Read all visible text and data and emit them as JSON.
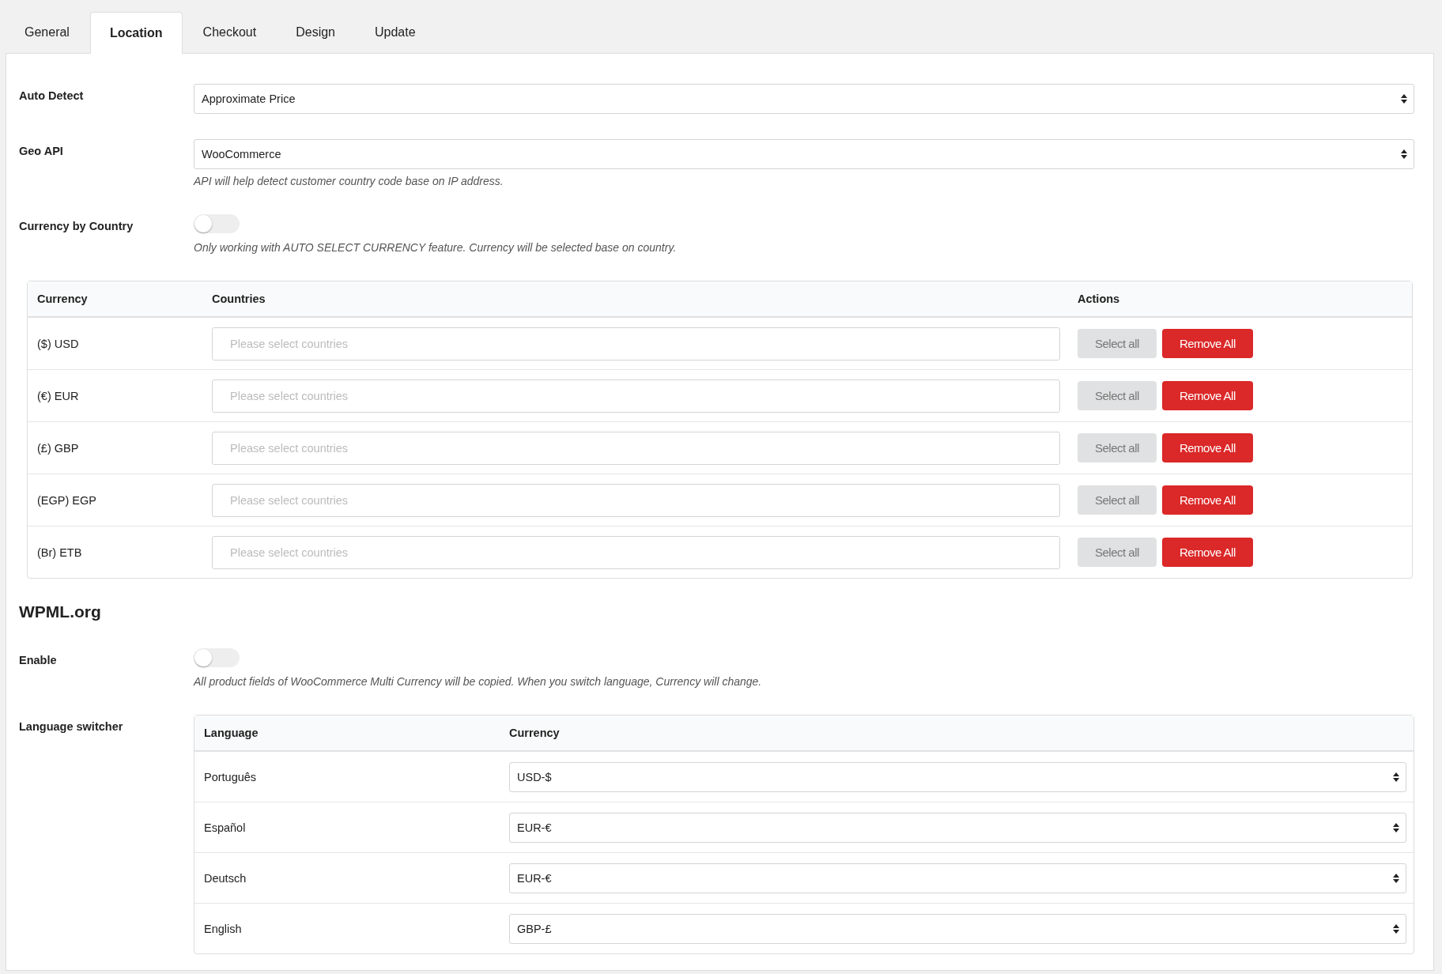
{
  "tabs": [
    {
      "label": "General",
      "selected": false
    },
    {
      "label": "Location",
      "selected": true
    },
    {
      "label": "Checkout",
      "selected": false
    },
    {
      "label": "Design",
      "selected": false
    },
    {
      "label": "Update",
      "selected": false
    }
  ],
  "settings": [
    {
      "label": "Auto Detect",
      "kind": "select",
      "value": "Approximate Price"
    },
    {
      "label": "Geo API",
      "kind": "select",
      "value": "WooCommerce",
      "hint": "API will help detect customer country code base on IP address."
    },
    {
      "label": "Currency by Country",
      "kind": "toggle",
      "on": false,
      "hint": "Only working with AUTO SELECT CURRENCY feature. Currency will be selected base on country."
    }
  ],
  "currency_table": {
    "columns": [
      "Currency",
      "Countries",
      "Actions"
    ],
    "rows": [
      {
        "currency": "($) USD",
        "placeholder": "Please select countries",
        "select_all": "Select all",
        "remove_all": "Remove All"
      },
      {
        "currency": "(€) EUR",
        "placeholder": "Please select countries",
        "select_all": "Select all",
        "remove_all": "Remove All"
      },
      {
        "currency": "(£) GBP",
        "placeholder": "Please select countries",
        "select_all": "Select all",
        "remove_all": "Remove All"
      },
      {
        "currency": "(EGP) EGP",
        "placeholder": "Please select countries",
        "select_all": "Select all",
        "remove_all": "Remove All"
      },
      {
        "currency": "(Br) ETB",
        "placeholder": "Please select countries",
        "select_all": "Select all",
        "remove_all": "Remove All"
      }
    ]
  },
  "wpml": {
    "heading": "WPML.org",
    "enable": {
      "label": "Enable",
      "on": false,
      "hint": "All product fields of WooCommerce Multi Currency will be copied. When you switch language, Currency will change."
    },
    "language_switcher": {
      "label": "Language switcher",
      "columns": [
        "Language",
        "Currency"
      ],
      "rows": [
        {
          "language": "Português",
          "currency": "USD-$"
        },
        {
          "language": "Español",
          "currency": "EUR-€"
        },
        {
          "language": "Deutsch",
          "currency": "EUR-€"
        },
        {
          "language": "English",
          "currency": "GBP-£"
        }
      ]
    }
  }
}
